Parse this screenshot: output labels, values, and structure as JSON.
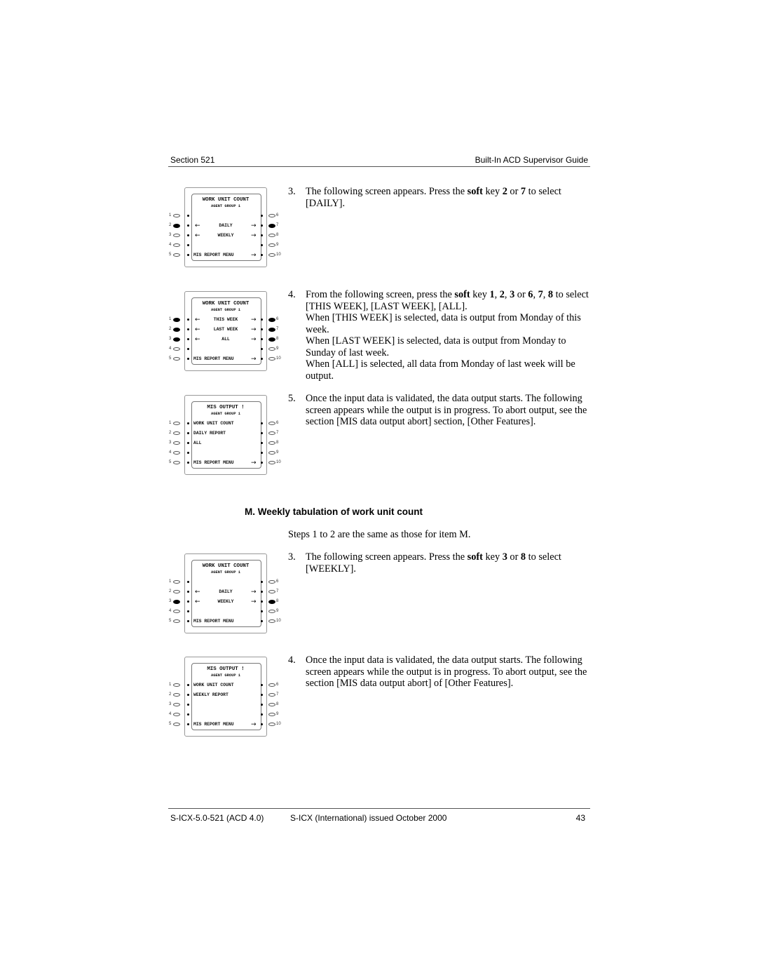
{
  "header": {
    "section": "Section 521",
    "guide": "Built-In ACD Supervisor Guide"
  },
  "footer": {
    "doc_id": "S-ICX-5.0-521 (ACD 4.0)",
    "issue": "S-ICX (International) issued October 2000",
    "page": "43"
  },
  "section_heading": "M. Weekly tabulation of work unit count",
  "steps_note": "Steps 1 to 2 are the same as those for item M.",
  "steps_a": [
    {
      "num": "3.",
      "parts": [
        "The following screen appears. Press the ",
        "soft",
        " key ",
        "2",
        " or ",
        "7",
        " to select [DAILY]."
      ]
    },
    {
      "num": "4.",
      "parts": [
        "From the following screen, press the ",
        "soft",
        " key ",
        "1",
        ", ",
        "2",
        ", ",
        "3",
        " or ",
        "6",
        ", ",
        "7",
        ", ",
        "8",
        " to select [THIS WEEK], [LAST WEEK], [ALL]."
      ],
      "notes": [
        "When [THIS WEEK] is selected, data is output from Monday of this week.",
        "When [LAST WEEK] is selected, data is output from Monday to Sunday of last week.",
        "When [ALL] is selected, all data from Monday of last week will be output."
      ]
    },
    {
      "num": "5.",
      "text": "Once the input data is validated, the data output starts. The following screen appears while the output is in progress. To abort output, see the section [MIS data output abort] section, [Other Features]."
    }
  ],
  "steps_b": [
    {
      "num": "3.",
      "parts": [
        "The following screen appears. Press the ",
        "soft",
        " key ",
        "3",
        " or ",
        "8",
        " to select [WEEKLY]."
      ]
    },
    {
      "num": "4.",
      "text": "Once the input data is validated, the data output starts. The following screen appears while the output is in progress. To abort output, see the section [MIS data output abort] of [Other Features]."
    }
  ],
  "panels": [
    {
      "title": "WORK UNIT COUNT",
      "subtitle": "AGENT GROUP 1",
      "rows": [
        {
          "text": "",
          "left_arrow": false,
          "right_arrow": false
        },
        {
          "text": "DAILY",
          "left_arrow": true,
          "right_arrow": true
        },
        {
          "text": "WEEKLY",
          "left_arrow": true,
          "right_arrow": true
        },
        {
          "text": "",
          "left_arrow": false,
          "right_arrow": false
        },
        {
          "text": "MIS REPORT MENU",
          "left_arrow": false,
          "right_arrow": true,
          "align": "left"
        }
      ],
      "active_keys": [
        2,
        7
      ]
    },
    {
      "title": "WORK UNIT COUNT",
      "subtitle": "AGENT GROUP 1",
      "rows": [
        {
          "text": "THIS WEEK",
          "left_arrow": true,
          "right_arrow": true
        },
        {
          "text": "LAST WEEK",
          "left_arrow": true,
          "right_arrow": true
        },
        {
          "text": "ALL",
          "left_arrow": true,
          "right_arrow": true
        },
        {
          "text": "",
          "left_arrow": false,
          "right_arrow": false
        },
        {
          "text": "MIS REPORT MENU",
          "left_arrow": false,
          "right_arrow": true,
          "align": "left"
        }
      ],
      "active_keys": [
        1,
        2,
        3,
        6,
        7,
        8
      ]
    },
    {
      "title": "MIS OUTPUT !",
      "subtitle": "AGENT GROUP 1",
      "rows": [
        {
          "text": "WORK UNIT COUNT",
          "left_arrow": false,
          "right_arrow": false,
          "align": "left"
        },
        {
          "text": "DAILY REPORT",
          "left_arrow": false,
          "right_arrow": false,
          "align": "left"
        },
        {
          "text": "ALL",
          "left_arrow": false,
          "right_arrow": false,
          "align": "left"
        },
        {
          "text": "",
          "left_arrow": false,
          "right_arrow": false
        },
        {
          "text": "MIS REPORT MENU",
          "left_arrow": false,
          "right_arrow": true,
          "align": "left"
        }
      ],
      "active_keys": []
    },
    {
      "title": "WORK UNIT COUNT",
      "subtitle": "AGENT GROUP 1",
      "rows": [
        {
          "text": "",
          "left_arrow": false,
          "right_arrow": false
        },
        {
          "text": "DAILY",
          "left_arrow": true,
          "right_arrow": true
        },
        {
          "text": "WEEKLY",
          "left_arrow": true,
          "right_arrow": true
        },
        {
          "text": "",
          "left_arrow": false,
          "right_arrow": false
        },
        {
          "text": "MIS REPORT MENU",
          "left_arrow": false,
          "right_arrow": false,
          "align": "left"
        }
      ],
      "active_keys": [
        3,
        8
      ]
    },
    {
      "title": "MIS OUTPUT !",
      "subtitle": "AGENT GROUP 1",
      "rows": [
        {
          "text": "WORK UNIT COUNT",
          "left_arrow": false,
          "right_arrow": false,
          "align": "left"
        },
        {
          "text": "WEEKLY REPORT",
          "left_arrow": false,
          "right_arrow": false,
          "align": "left"
        },
        {
          "text": "",
          "left_arrow": false,
          "right_arrow": false
        },
        {
          "text": "",
          "left_arrow": false,
          "right_arrow": false
        },
        {
          "text": "MIS REPORT MENU",
          "left_arrow": false,
          "right_arrow": true,
          "align": "left"
        }
      ],
      "active_keys": []
    }
  ],
  "icons": {
    "left_arrow": "left-arrow-icon",
    "right_arrow": "right-arrow-icon",
    "soft_key": "soft-key-lamp-icon"
  }
}
